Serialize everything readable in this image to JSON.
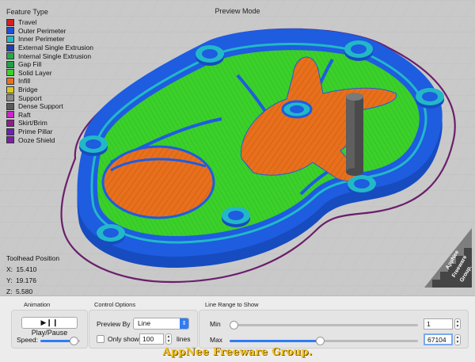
{
  "viewport": {
    "mode_title": "Preview Mode"
  },
  "legend": {
    "title": "Feature Type",
    "items": [
      {
        "label": "Travel",
        "color": "#d42020"
      },
      {
        "label": "Outer Perimeter",
        "color": "#1f4fd8"
      },
      {
        "label": "Inner Perimeter",
        "color": "#22b8c8"
      },
      {
        "label": "External Single Extrusion",
        "color": "#1e3fb0"
      },
      {
        "label": "Internal Single Extrusion",
        "color": "#27a84a"
      },
      {
        "label": "Gap Fill",
        "color": "#1fa046"
      },
      {
        "label": "Solid Layer",
        "color": "#3bd02a"
      },
      {
        "label": "Infill",
        "color": "#e8701c"
      },
      {
        "label": "Bridge",
        "color": "#d8c81c"
      },
      {
        "label": "Support",
        "color": "#8a8a8a"
      },
      {
        "label": "Dense Support",
        "color": "#5a5a5a"
      },
      {
        "label": "Raft",
        "color": "#c826c8"
      },
      {
        "label": "Skirt/Brim",
        "color": "#8c1e8c"
      },
      {
        "label": "Prime Pillar",
        "color": "#6c20b4"
      },
      {
        "label": "Ooze Shield",
        "color": "#7a22a6"
      }
    ]
  },
  "toolhead": {
    "title": "Toolhead Position",
    "x_label": "X:",
    "x_value": "15.410",
    "y_label": "Y:",
    "y_value": "19.176",
    "z_label": "Z:",
    "z_value": "5.580"
  },
  "animation": {
    "title": "Animation",
    "play_label": "▶❙❙ Play/Pause",
    "speed_label": "Speed:",
    "speed_level": 0.85
  },
  "control_options": {
    "title": "Control Options",
    "preview_by_label": "Preview By",
    "preview_by_value": "Line",
    "only_show_label": "Only show",
    "only_show_value": "100",
    "lines_label": "lines",
    "only_show_checked": false
  },
  "line_range": {
    "title": "Line Range to Show",
    "min_label": "Min",
    "min_value": "1",
    "min_level": 0.0,
    "max_label": "Max",
    "max_value": "67104",
    "max_level": 0.48
  },
  "brand": {
    "text": "AppNee Freeware Group."
  },
  "watermark": {
    "line1": "AppNee",
    "line2": "Freeware",
    "line3": "Group."
  },
  "colors": {
    "viewport_bg": "#c9c9c9",
    "accent": "#2f7cf6",
    "model_base": "#1e5ce0",
    "model_infill": "#e8701c",
    "model_solid": "#3bd02a",
    "model_inner": "#22b8c8",
    "skirt": "#6a1f6a",
    "pillar": "#5f5f5f"
  }
}
